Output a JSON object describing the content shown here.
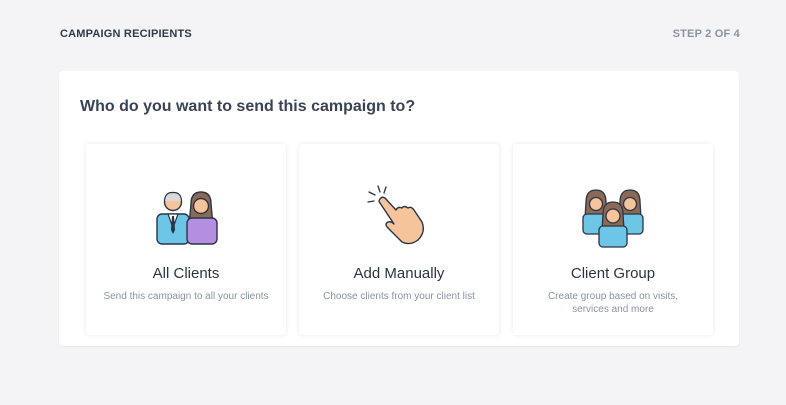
{
  "header": {
    "title": "CAMPAIGN RECIPIENTS",
    "step": "STEP 2 OF 4"
  },
  "main": {
    "question": "Who do you want to send this campaign to?",
    "options": [
      {
        "label": "All Clients",
        "description": "Send this campaign to all your clients",
        "icon": "people-icon"
      },
      {
        "label": "Add Manually",
        "description": "Choose clients from your client list",
        "icon": "hand-pointer-icon"
      },
      {
        "label": "Client Group",
        "description": "Create group based on visits, services and more",
        "icon": "group-icon"
      }
    ]
  },
  "colors": {
    "background": "#f4f4f6",
    "card": "#ffffff",
    "accent_blue": "#6ec6e6",
    "accent_purple": "#b48ee0",
    "skin": "#f5c49a"
  }
}
